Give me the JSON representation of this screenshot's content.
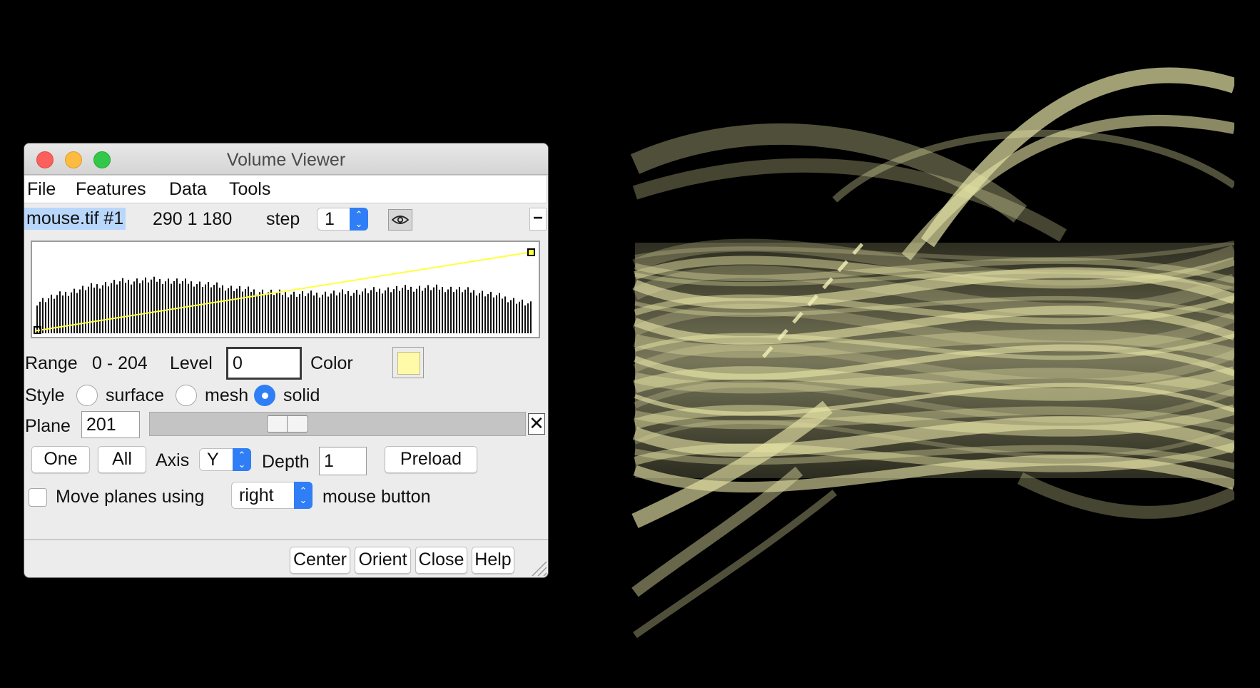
{
  "window": {
    "title": "Volume Viewer"
  },
  "menubar": {
    "items": [
      "File",
      "Features",
      "Data",
      "Tools"
    ]
  },
  "dataset": {
    "name": "mouse.tif #1",
    "size": "290 1 180",
    "step_label": "step",
    "step_value": "1"
  },
  "threshold": {
    "range_label": "Range",
    "range_value": "0 - 204",
    "level_label": "Level",
    "level_value": "0",
    "color_label": "Color",
    "color": "#fffaa8"
  },
  "style": {
    "label": "Style",
    "options": [
      "surface",
      "mesh",
      "solid"
    ],
    "selected": "solid"
  },
  "plane": {
    "label": "Plane",
    "value": "201",
    "slider_fraction": 0.35
  },
  "plane_controls": {
    "one_label": "One",
    "all_label": "All",
    "axis_label": "Axis",
    "axis_value": "Y",
    "depth_label": "Depth",
    "depth_value": "1",
    "preload_label": "Preload"
  },
  "move_planes": {
    "checked": false,
    "prefix": "Move planes using",
    "button_value": "right",
    "suffix": "mouse button"
  },
  "footer": {
    "buttons": [
      "Center",
      "Orient",
      "Close",
      "Help"
    ]
  },
  "icons": {
    "close": "close-icon",
    "eye": "eye-icon",
    "minus": "minus-icon",
    "x": "x-icon"
  },
  "colors": {
    "accent": "#2f7ef6",
    "selection": "#b8d7fb",
    "histogram_line": "#ffff3c",
    "volume_tint": "#e6e4a6"
  }
}
